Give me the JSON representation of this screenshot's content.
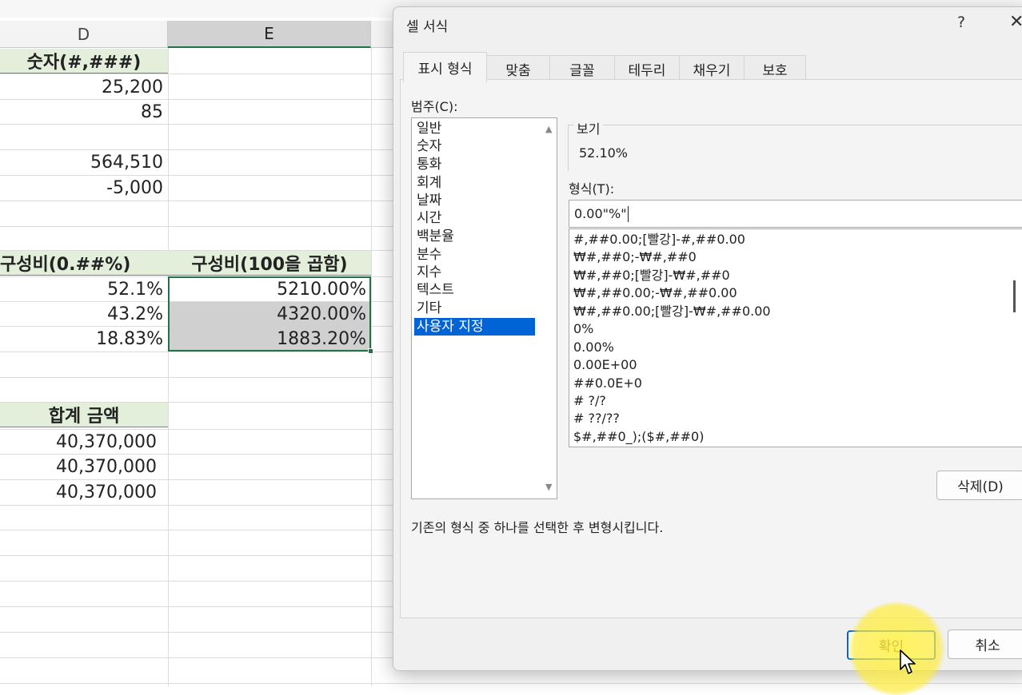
{
  "sheet": {
    "col_headers": [
      "D",
      "E"
    ],
    "cells": {
      "d_header": "숫자(#,###)",
      "d_values": [
        "25,200",
        "85",
        "",
        "564,510",
        "-5,000"
      ],
      "d_pct_header": "구성비(0.##%)",
      "e_pct_header": "구성비(100을 곱함)",
      "d_pct_values": [
        "52.1%",
        "43.2%",
        "18.83%"
      ],
      "e_pct_values": [
        "5210.00%",
        "4320.00%",
        "1883.20%"
      ],
      "sum_header": "합계 금액",
      "sum_values": [
        "40,370,000",
        "40,370,000",
        "40,370,000"
      ]
    },
    "colors": {
      "header_fill": "#e3efda",
      "selection_border": "#217346",
      "selected_fill": "#d0d0d0"
    }
  },
  "dialog": {
    "title": "셀 서식",
    "help_glyph": "?",
    "close_glyph": "✕",
    "tabs": [
      "표시 형식",
      "맞춤",
      "글꼴",
      "테두리",
      "채우기",
      "보호"
    ],
    "active_tab": "표시 형식",
    "category_label": "범주(C):",
    "categories": [
      "일반",
      "숫자",
      "통화",
      "회계",
      "날짜",
      "시간",
      "백분율",
      "분수",
      "지수",
      "텍스트",
      "기타",
      "사용자 지정"
    ],
    "selected_category": "사용자 지정",
    "preview_label": "보기",
    "preview_value": "52.10%",
    "format_label": "형식(T):",
    "format_input": "0.00\"%\"",
    "format_list": [
      "#,##0.00;[빨강]-#,##0.00",
      "₩#,##0;-₩#,##0",
      "₩#,##0;[빨강]-₩#,##0",
      "₩#,##0.00;-₩#,##0.00",
      "₩#,##0.00;[빨강]-₩#,##0.00",
      "0%",
      "0.00%",
      "0.00E+00",
      "##0.0E+0",
      "# ?/?",
      "# ??/??",
      "$#,##0_);($#,##0)"
    ],
    "delete_button": "삭제(D)",
    "description": "기존의 형식 중 하나를 선택한 후 변형시킵니다.",
    "ok_button": "확인",
    "cancel_button": "취소",
    "accent_color": "#0064d6"
  }
}
